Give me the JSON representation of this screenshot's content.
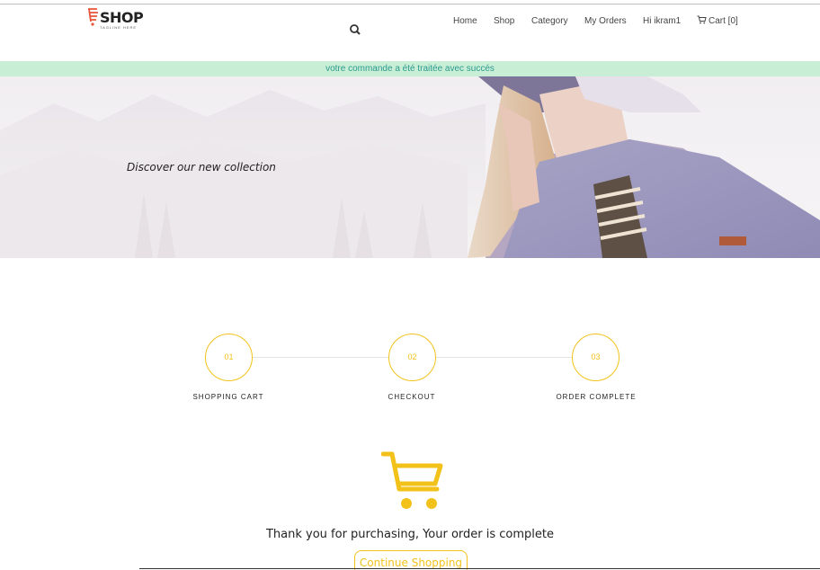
{
  "header": {
    "logo_text": "SHOP",
    "logo_tagline": "TAGLINE HERE",
    "nav": [
      {
        "label": "Home"
      },
      {
        "label": "Shop"
      },
      {
        "label": "Category"
      },
      {
        "label": "My Orders"
      },
      {
        "label": "Hi ikram1"
      }
    ],
    "cart_label": "Cart [0]"
  },
  "alert": {
    "message": "votre commande a été traitée avec succés"
  },
  "hero": {
    "tagline": "Discover our new collection"
  },
  "steps": [
    {
      "number": "01",
      "label": "SHOPPING CART"
    },
    {
      "number": "02",
      "label": "CHECKOUT"
    },
    {
      "number": "03",
      "label": "ORDER COMPLETE"
    }
  ],
  "confirmation": {
    "message": "Thank you for purchasing, Your order is complete",
    "button_label": "Continue Shopping"
  },
  "colors": {
    "accent": "#f2c21b",
    "alert_bg": "#c9eed6",
    "alert_text": "#2b9a8f",
    "logo_accent": "#e8553a"
  }
}
